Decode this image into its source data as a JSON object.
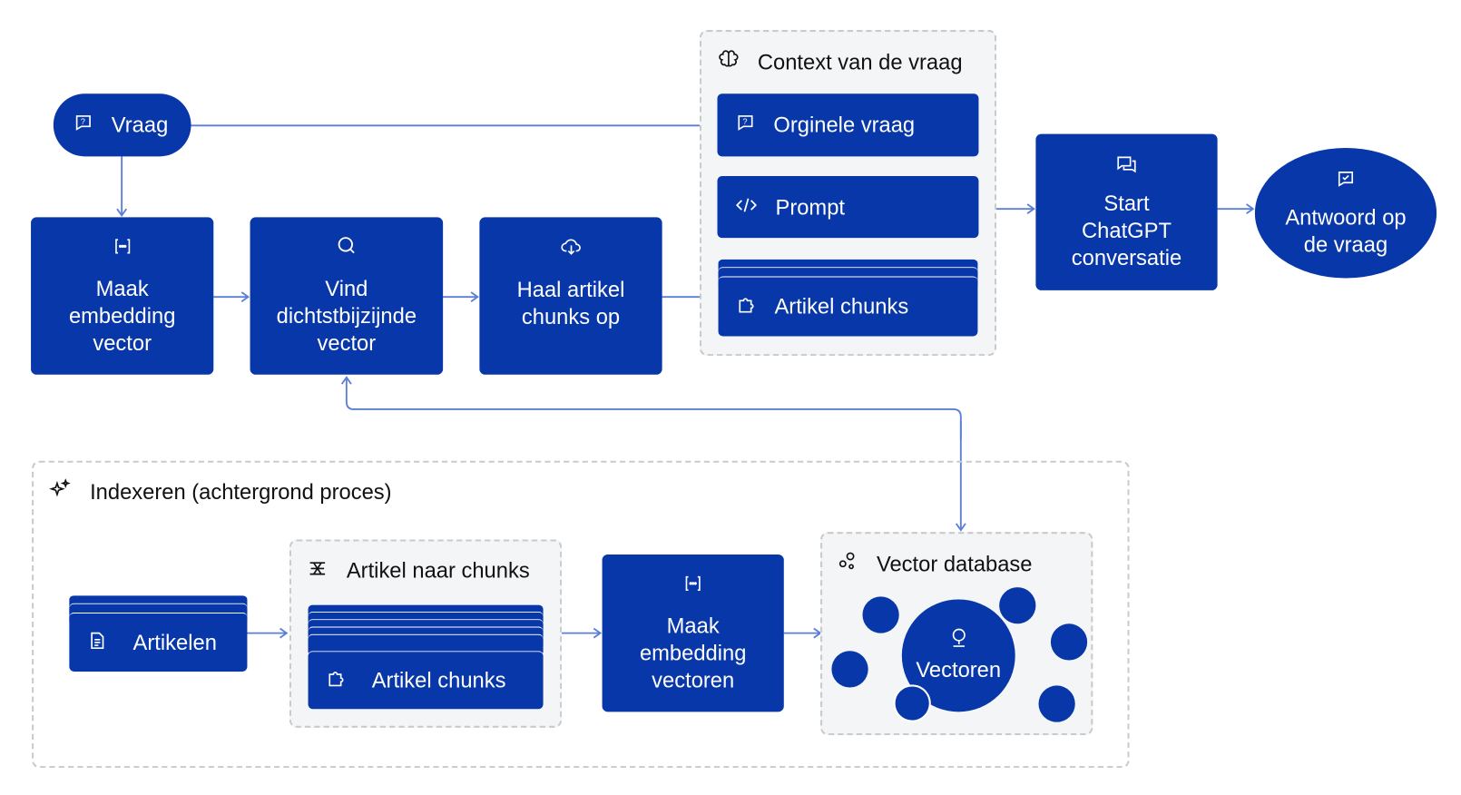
{
  "colors": {
    "node": "#0737A8",
    "arrow": "#5B7FD6",
    "group_bg": "#F4F5F7",
    "group_border": "#C9CACD"
  },
  "query": {
    "label": "Vraag",
    "icon": "message-question-icon"
  },
  "steps": [
    {
      "label": "Maak embedding vector",
      "icon": "brackets-dots-icon"
    },
    {
      "label": "Vind dichtstbijzijnde vector",
      "icon": "search-icon"
    },
    {
      "label": "Haal artikel chunks op",
      "icon": "cloud-download-icon"
    }
  ],
  "context": {
    "title": "Context van de vraag",
    "icon": "brain-icon",
    "items": [
      {
        "label": "Orginele vraag",
        "icon": "message-question-icon"
      },
      {
        "label": "Prompt",
        "icon": "code-icon"
      },
      {
        "label": "Artikel chunks",
        "icon": "puzzle-icon"
      }
    ]
  },
  "chatgpt": {
    "label": "Start ChatGPT conversatie",
    "icon": "chat-bubbles-icon"
  },
  "answer": {
    "label": "Antwoord op de vraag",
    "icon": "message-check-icon"
  },
  "indexing": {
    "title": "Indexeren (achtergrond proces)",
    "icon": "sparkles-icon",
    "articles": {
      "label": "Artikelen",
      "icon": "file-text-icon"
    },
    "chunking": {
      "title": "Artikel naar chunks",
      "icon": "split-icon",
      "item": {
        "label": "Artikel chunks",
        "icon": "puzzle-icon"
      }
    },
    "embed": {
      "label": "Maak embedding vectoren",
      "icon": "brackets-dots-icon"
    },
    "vectordb": {
      "title": "Vector database",
      "icon": "circles-icon",
      "center": {
        "label": "Vectoren",
        "icon": "location-pin-icon"
      }
    }
  }
}
